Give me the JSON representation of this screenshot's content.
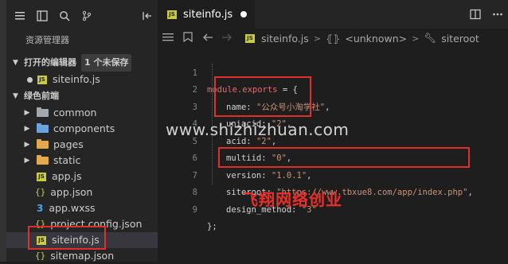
{
  "sidebar": {
    "title": "资源管理器",
    "open_editors": {
      "label": "打开的编辑器",
      "badge": "1 个未保存",
      "items": [
        {
          "label": "siteinfo.js"
        }
      ]
    },
    "project": {
      "label": "绿色前端",
      "items": [
        {
          "label": "common",
          "type": "folder"
        },
        {
          "label": "components",
          "type": "folder"
        },
        {
          "label": "pages",
          "type": "folder"
        },
        {
          "label": "static",
          "type": "folder"
        },
        {
          "label": "app.js",
          "type": "js"
        },
        {
          "label": "app.json",
          "type": "json"
        },
        {
          "label": "app.wxss",
          "type": "css"
        },
        {
          "label": "project.config.json",
          "type": "json"
        },
        {
          "label": "siteinfo.js",
          "type": "js"
        },
        {
          "label": "sitemap.json",
          "type": "json"
        }
      ]
    }
  },
  "editor": {
    "tab_label": "siteinfo.js",
    "breadcrumbs": {
      "file": "siteinfo.js",
      "symbol": "<unknown>",
      "prop": "siteroot"
    },
    "code": {
      "l1": {
        "a": "module.exports",
        "b": " = {"
      },
      "l2": {
        "key": "name: ",
        "val": "\"公众号小淘学社\"",
        "end": ","
      },
      "l3": {
        "key": "uniacid: ",
        "val": "\"2\"",
        "end": ","
      },
      "l4": {
        "key": "acid: ",
        "val": "\"2\"",
        "end": ","
      },
      "l5": {
        "key": "multiid: ",
        "val": "\"0\"",
        "end": ","
      },
      "l6": {
        "key": "version: ",
        "val": "\"1.0.1\"",
        "end": ","
      },
      "l7": {
        "key": "siteroot: ",
        "val": "\"https://www.tbxue8.com/app/index.php\"",
        "end": ","
      },
      "l8": {
        "key": "design_method: ",
        "val": "\"3\""
      },
      "l9": {
        "a": "};"
      }
    },
    "line_numbers": [
      "1",
      "2",
      "3",
      "4",
      "5",
      "6",
      "7",
      "8",
      "9"
    ]
  },
  "overlay": {
    "watermark": "www.shizhizhuan.com",
    "red_text": "飞翔网络创业"
  },
  "colors": {
    "highlight_box": "#e0302a",
    "js_icon": "#cbcb41"
  }
}
